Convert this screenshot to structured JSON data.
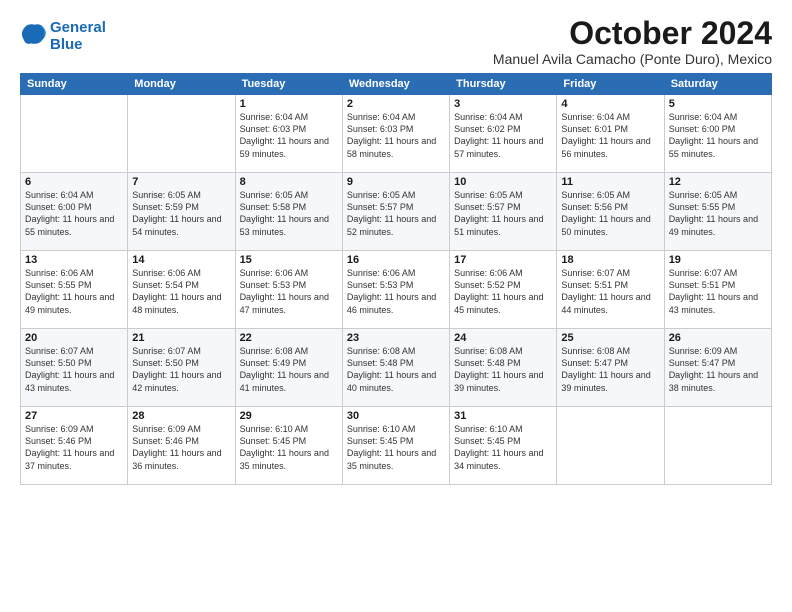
{
  "logo": {
    "text_part1": "General",
    "text_part2": "Blue"
  },
  "title": "October 2024",
  "location": "Manuel Avila Camacho (Ponte Duro), Mexico",
  "days_of_week": [
    "Sunday",
    "Monday",
    "Tuesday",
    "Wednesday",
    "Thursday",
    "Friday",
    "Saturday"
  ],
  "weeks": [
    [
      {
        "day": "",
        "sunrise": "",
        "sunset": "",
        "daylight": ""
      },
      {
        "day": "",
        "sunrise": "",
        "sunset": "",
        "daylight": ""
      },
      {
        "day": "1",
        "sunrise": "Sunrise: 6:04 AM",
        "sunset": "Sunset: 6:03 PM",
        "daylight": "Daylight: 11 hours and 59 minutes."
      },
      {
        "day": "2",
        "sunrise": "Sunrise: 6:04 AM",
        "sunset": "Sunset: 6:03 PM",
        "daylight": "Daylight: 11 hours and 58 minutes."
      },
      {
        "day": "3",
        "sunrise": "Sunrise: 6:04 AM",
        "sunset": "Sunset: 6:02 PM",
        "daylight": "Daylight: 11 hours and 57 minutes."
      },
      {
        "day": "4",
        "sunrise": "Sunrise: 6:04 AM",
        "sunset": "Sunset: 6:01 PM",
        "daylight": "Daylight: 11 hours and 56 minutes."
      },
      {
        "day": "5",
        "sunrise": "Sunrise: 6:04 AM",
        "sunset": "Sunset: 6:00 PM",
        "daylight": "Daylight: 11 hours and 55 minutes."
      }
    ],
    [
      {
        "day": "6",
        "sunrise": "Sunrise: 6:04 AM",
        "sunset": "Sunset: 6:00 PM",
        "daylight": "Daylight: 11 hours and 55 minutes."
      },
      {
        "day": "7",
        "sunrise": "Sunrise: 6:05 AM",
        "sunset": "Sunset: 5:59 PM",
        "daylight": "Daylight: 11 hours and 54 minutes."
      },
      {
        "day": "8",
        "sunrise": "Sunrise: 6:05 AM",
        "sunset": "Sunset: 5:58 PM",
        "daylight": "Daylight: 11 hours and 53 minutes."
      },
      {
        "day": "9",
        "sunrise": "Sunrise: 6:05 AM",
        "sunset": "Sunset: 5:57 PM",
        "daylight": "Daylight: 11 hours and 52 minutes."
      },
      {
        "day": "10",
        "sunrise": "Sunrise: 6:05 AM",
        "sunset": "Sunset: 5:57 PM",
        "daylight": "Daylight: 11 hours and 51 minutes."
      },
      {
        "day": "11",
        "sunrise": "Sunrise: 6:05 AM",
        "sunset": "Sunset: 5:56 PM",
        "daylight": "Daylight: 11 hours and 50 minutes."
      },
      {
        "day": "12",
        "sunrise": "Sunrise: 6:05 AM",
        "sunset": "Sunset: 5:55 PM",
        "daylight": "Daylight: 11 hours and 49 minutes."
      }
    ],
    [
      {
        "day": "13",
        "sunrise": "Sunrise: 6:06 AM",
        "sunset": "Sunset: 5:55 PM",
        "daylight": "Daylight: 11 hours and 49 minutes."
      },
      {
        "day": "14",
        "sunrise": "Sunrise: 6:06 AM",
        "sunset": "Sunset: 5:54 PM",
        "daylight": "Daylight: 11 hours and 48 minutes."
      },
      {
        "day": "15",
        "sunrise": "Sunrise: 6:06 AM",
        "sunset": "Sunset: 5:53 PM",
        "daylight": "Daylight: 11 hours and 47 minutes."
      },
      {
        "day": "16",
        "sunrise": "Sunrise: 6:06 AM",
        "sunset": "Sunset: 5:53 PM",
        "daylight": "Daylight: 11 hours and 46 minutes."
      },
      {
        "day": "17",
        "sunrise": "Sunrise: 6:06 AM",
        "sunset": "Sunset: 5:52 PM",
        "daylight": "Daylight: 11 hours and 45 minutes."
      },
      {
        "day": "18",
        "sunrise": "Sunrise: 6:07 AM",
        "sunset": "Sunset: 5:51 PM",
        "daylight": "Daylight: 11 hours and 44 minutes."
      },
      {
        "day": "19",
        "sunrise": "Sunrise: 6:07 AM",
        "sunset": "Sunset: 5:51 PM",
        "daylight": "Daylight: 11 hours and 43 minutes."
      }
    ],
    [
      {
        "day": "20",
        "sunrise": "Sunrise: 6:07 AM",
        "sunset": "Sunset: 5:50 PM",
        "daylight": "Daylight: 11 hours and 43 minutes."
      },
      {
        "day": "21",
        "sunrise": "Sunrise: 6:07 AM",
        "sunset": "Sunset: 5:50 PM",
        "daylight": "Daylight: 11 hours and 42 minutes."
      },
      {
        "day": "22",
        "sunrise": "Sunrise: 6:08 AM",
        "sunset": "Sunset: 5:49 PM",
        "daylight": "Daylight: 11 hours and 41 minutes."
      },
      {
        "day": "23",
        "sunrise": "Sunrise: 6:08 AM",
        "sunset": "Sunset: 5:48 PM",
        "daylight": "Daylight: 11 hours and 40 minutes."
      },
      {
        "day": "24",
        "sunrise": "Sunrise: 6:08 AM",
        "sunset": "Sunset: 5:48 PM",
        "daylight": "Daylight: 11 hours and 39 minutes."
      },
      {
        "day": "25",
        "sunrise": "Sunrise: 6:08 AM",
        "sunset": "Sunset: 5:47 PM",
        "daylight": "Daylight: 11 hours and 39 minutes."
      },
      {
        "day": "26",
        "sunrise": "Sunrise: 6:09 AM",
        "sunset": "Sunset: 5:47 PM",
        "daylight": "Daylight: 11 hours and 38 minutes."
      }
    ],
    [
      {
        "day": "27",
        "sunrise": "Sunrise: 6:09 AM",
        "sunset": "Sunset: 5:46 PM",
        "daylight": "Daylight: 11 hours and 37 minutes."
      },
      {
        "day": "28",
        "sunrise": "Sunrise: 6:09 AM",
        "sunset": "Sunset: 5:46 PM",
        "daylight": "Daylight: 11 hours and 36 minutes."
      },
      {
        "day": "29",
        "sunrise": "Sunrise: 6:10 AM",
        "sunset": "Sunset: 5:45 PM",
        "daylight": "Daylight: 11 hours and 35 minutes."
      },
      {
        "day": "30",
        "sunrise": "Sunrise: 6:10 AM",
        "sunset": "Sunset: 5:45 PM",
        "daylight": "Daylight: 11 hours and 35 minutes."
      },
      {
        "day": "31",
        "sunrise": "Sunrise: 6:10 AM",
        "sunset": "Sunset: 5:45 PM",
        "daylight": "Daylight: 11 hours and 34 minutes."
      },
      {
        "day": "",
        "sunrise": "",
        "sunset": "",
        "daylight": ""
      },
      {
        "day": "",
        "sunrise": "",
        "sunset": "",
        "daylight": ""
      }
    ]
  ]
}
